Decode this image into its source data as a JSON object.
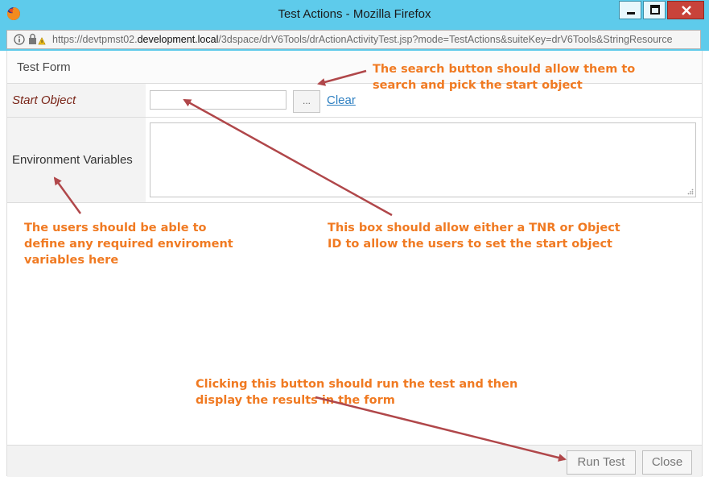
{
  "window": {
    "title": "Test Actions - Mozilla Firefox",
    "url_prefix": "https://devtpmst02.",
    "url_host": "development.local",
    "url_rest": "/3dspace/drV6Tools/drActionActivityTest.jsp?mode=TestActions&suiteKey=drV6Tools&StringResource"
  },
  "form": {
    "title": "Test Form",
    "start_object_label": "Start Object",
    "start_object_value": "",
    "browse_button_label": "...",
    "clear_link_label": "Clear",
    "env_label": "Environment Variables",
    "env_value": ""
  },
  "footer": {
    "run_label": "Run Test",
    "close_label": "Close"
  },
  "annotations": {
    "search": "The search button should allow them to search and pick the start object",
    "env": "The users should be able to define any required enviroment variables here",
    "box": "This box should allow either a TNR or Object ID to allow the users to set the start object",
    "run": "Clicking this button should run the test and then display the results in the form",
    "color": "#f07a22",
    "arrow_color": "#b0474a"
  },
  "colors": {
    "titlebar": "#5ecbeb",
    "close_button": "#c8433a",
    "start_label": "#7a2619",
    "link": "#2d7fc1"
  }
}
